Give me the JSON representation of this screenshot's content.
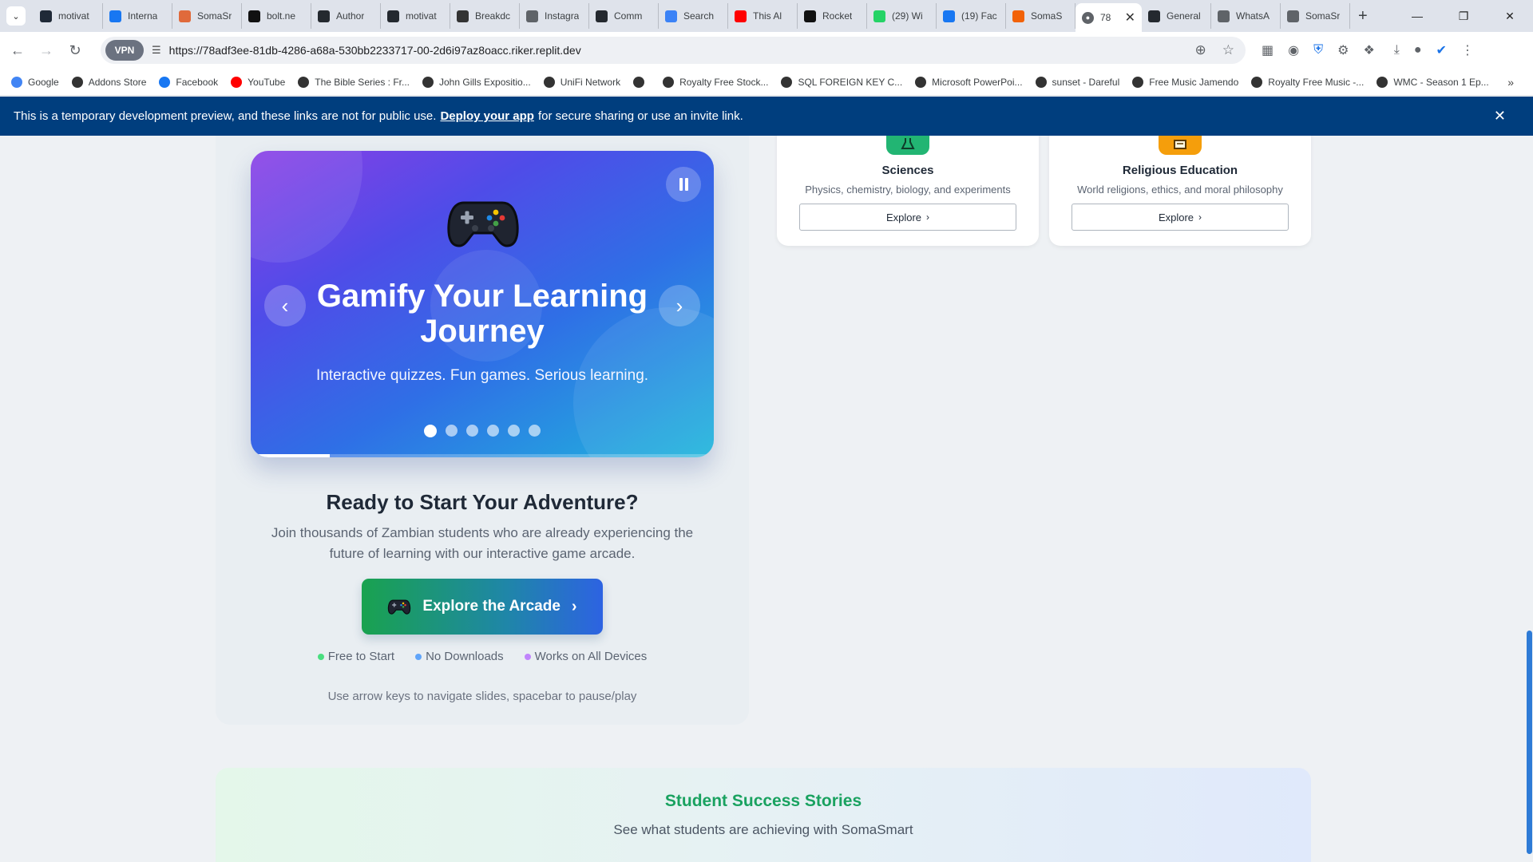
{
  "browser": {
    "tabs": [
      {
        "title": "motivat",
        "icon": "activity-icon",
        "color": "#1f2937"
      },
      {
        "title": "Interna",
        "icon": "butterfly-icon",
        "color": "#1877f2"
      },
      {
        "title": "SomaSr",
        "icon": "sparkle-icon",
        "color": "#e06a3b"
      },
      {
        "title": "bolt.ne",
        "icon": "bolt-icon",
        "color": "#111111"
      },
      {
        "title": "Author",
        "icon": "github-icon",
        "color": "#24292f"
      },
      {
        "title": "motivat",
        "icon": "github-icon",
        "color": "#24292f"
      },
      {
        "title": "Breakdc",
        "icon": "breakdown-icon",
        "color": "#333333"
      },
      {
        "title": "Instagra",
        "icon": "globe-icon",
        "color": "#5f6368"
      },
      {
        "title": "Comm",
        "icon": "github-icon",
        "color": "#24292f"
      },
      {
        "title": "Search",
        "icon": "search-engine-icon",
        "color": "#3b82f6"
      },
      {
        "title": "This Al",
        "icon": "youtube-icon",
        "color": "#ff0000"
      },
      {
        "title": "Rocket",
        "icon": "rocket-icon",
        "color": "#111111"
      },
      {
        "title": "(29) Wi",
        "icon": "whatsapp-icon",
        "color": "#25d366"
      },
      {
        "title": "(19) Fac",
        "icon": "facebook-icon",
        "color": "#1877f2"
      },
      {
        "title": "SomaS",
        "icon": "replit-icon",
        "color": "#f26207"
      }
    ],
    "active_tab": {
      "title": "78",
      "icon": "globe-icon"
    },
    "tabs_after": [
      {
        "title": "General",
        "icon": "github-icon",
        "color": "#24292f"
      },
      {
        "title": "WhatsA",
        "icon": "globe-icon",
        "color": "#5f6368"
      },
      {
        "title": "SomaSr",
        "icon": "globe-icon",
        "color": "#5f6368"
      }
    ],
    "vpn_label": "VPN",
    "url": "https://78adf3ee-81db-4286-a68a-530bb2233717-00-2d6i97az8oacc.riker.replit.dev",
    "bookmarks": [
      {
        "label": "Google",
        "color": "#4285f4"
      },
      {
        "label": "Addons Store",
        "color": "#333333"
      },
      {
        "label": "Facebook",
        "color": "#1877f2"
      },
      {
        "label": "YouTube",
        "color": "#ff0000"
      },
      {
        "label": "The Bible Series : Fr...",
        "color": "#333333"
      },
      {
        "label": "John Gills Expositio...",
        "color": "#333333"
      },
      {
        "label": "UniFi Network",
        "color": "#333333"
      },
      {
        "label": "",
        "color": "#333333"
      },
      {
        "label": "Royalty Free Stock...",
        "color": "#333333"
      },
      {
        "label": "SQL FOREIGN KEY C...",
        "color": "#333333"
      },
      {
        "label": "Microsoft PowerPoi...",
        "color": "#333333"
      },
      {
        "label": "sunset - Dareful",
        "color": "#333333"
      },
      {
        "label": "Free Music Jamendo",
        "color": "#333333"
      },
      {
        "label": "Royalty Free Music -...",
        "color": "#333333"
      },
      {
        "label": "WMC - Season 1 Ep...",
        "color": "#333333"
      }
    ]
  },
  "banner": {
    "text_before": "This is a temporary development preview, and these links are not for public use.",
    "link": "Deploy your app",
    "text_after": "for secure sharing or use an invite link."
  },
  "carousel": {
    "title": "Gamify Your Learning Journey",
    "subtitle": "Interactive quizzes. Fun games. Serious learning.",
    "icon": "gamepad-icon",
    "slide_count": 6,
    "active_slide": 1,
    "progress": 0.17
  },
  "cta": {
    "title": "Ready to Start Your Adventure?",
    "description": "Join thousands of Zambian students who are already experiencing the future of learning with our interactive game arcade.",
    "button_label": "Explore the Arcade",
    "features": [
      {
        "label": "Free to Start",
        "color": "#4ade80"
      },
      {
        "label": "No Downloads",
        "color": "#60a5fa"
      },
      {
        "label": "Works on All Devices",
        "color": "#c084fc"
      }
    ],
    "hint": "Use arrow keys to navigate slides, spacebar to pause/play"
  },
  "subjects": [
    {
      "name": "Sciences",
      "description": "Physics, chemistry, biology, and experiments",
      "button": "Explore",
      "icon": "flask-icon",
      "color": "#22b573"
    },
    {
      "name": "Religious Education",
      "description": "World religions, ethics, and moral philosophy",
      "button": "Explore",
      "icon": "book-icon",
      "color": "#f59e0b"
    }
  ],
  "stories": {
    "title": "Student Success Stories",
    "subtitle": "See what students are achieving with SomaSmart"
  }
}
